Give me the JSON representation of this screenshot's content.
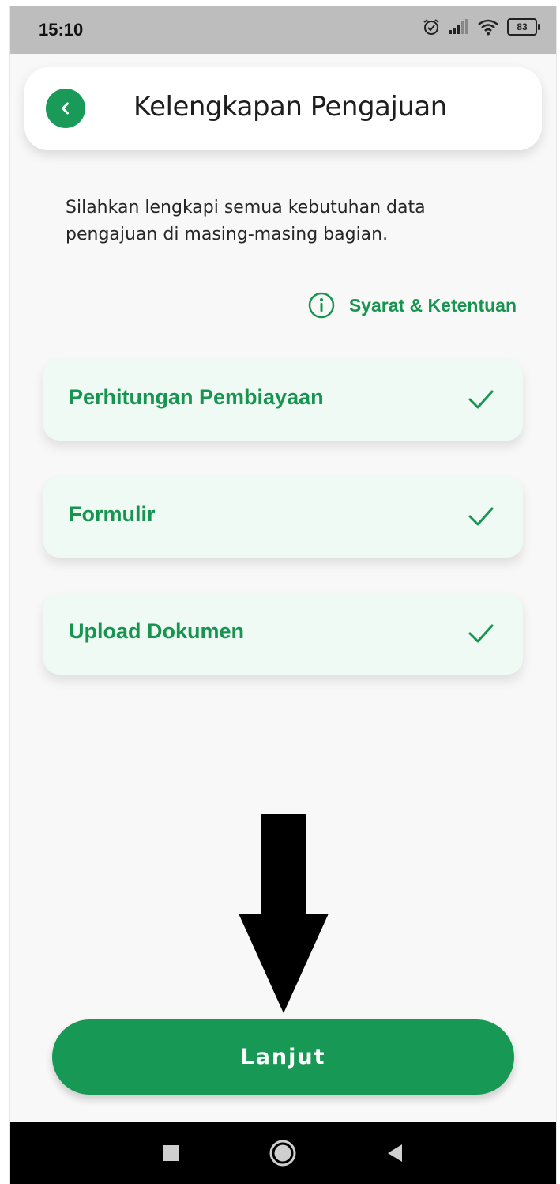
{
  "status_bar": {
    "time": "15:10",
    "battery": "83",
    "icons": [
      "alarm-icon",
      "signal-icon",
      "wifi-icon",
      "battery-icon"
    ]
  },
  "header": {
    "title": "Kelengkapan Pengajuan",
    "back_icon": "chevron-left-icon"
  },
  "description": "Silahkan lengkapi semua kebutuhan data pengajuan di masing-masing bagian.",
  "terms_link": {
    "label": "Syarat & Ketentuan",
    "icon": "info-icon"
  },
  "sections": [
    {
      "label": "Perhitungan Pembiayaan",
      "completed": true
    },
    {
      "label": "Formulir",
      "completed": true
    },
    {
      "label": "Upload Dokumen",
      "completed": true
    }
  ],
  "primary_button": {
    "label": "Lanjut"
  },
  "nav_bar": {
    "buttons": [
      "recent-apps-button",
      "home-button",
      "back-button"
    ]
  },
  "colors": {
    "accent": "#179955",
    "card_bg": "#eefaf3",
    "background": "#f8f8f8",
    "status_bar": "#bdbdbd"
  }
}
